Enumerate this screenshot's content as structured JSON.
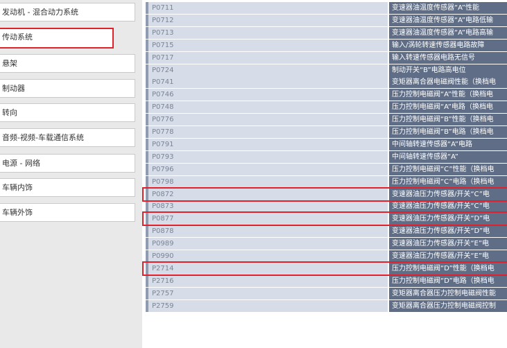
{
  "sidebar": {
    "items": [
      {
        "label": "发动机 - 混合动力系统",
        "selected": false
      },
      {
        "label": "传动系统",
        "selected": true
      },
      {
        "label": "悬架",
        "selected": false
      },
      {
        "label": "制动器",
        "selected": false
      },
      {
        "label": "转向",
        "selected": false
      },
      {
        "label": "音频-视频-车载通信系统",
        "selected": false
      },
      {
        "label": "电源 - 网络",
        "selected": false
      },
      {
        "label": "车辆内饰",
        "selected": false
      },
      {
        "label": "车辆外饰",
        "selected": false
      }
    ]
  },
  "dtc_list": {
    "rows": [
      {
        "code": "P0711",
        "desc": "变速器油温度传感器“A”性能",
        "highlighted": false
      },
      {
        "code": "P0712",
        "desc": "变速器油温度传感器“A”电路低输",
        "highlighted": false
      },
      {
        "code": "P0713",
        "desc": "变速器油温度传感器“A”电路高输",
        "highlighted": false
      },
      {
        "code": "P0715",
        "desc": "输入/涡轮转速传感器电路故障",
        "highlighted": false
      },
      {
        "code": "P0717",
        "desc": "输入转速传感器电路无信号",
        "highlighted": false
      },
      {
        "code": "P0724",
        "desc": "制动开关“B”电路高电位",
        "highlighted": false
      },
      {
        "code": "P0741",
        "desc": "变矩器离合器电磁阀性能（换档电",
        "highlighted": false
      },
      {
        "code": "P0746",
        "desc": "压力控制电磁阀“A”性能（换档电",
        "highlighted": false
      },
      {
        "code": "P0748",
        "desc": "压力控制电磁阀“A”电路（换档电",
        "highlighted": false
      },
      {
        "code": "P0776",
        "desc": "压力控制电磁阀“B”性能（换档电",
        "highlighted": false
      },
      {
        "code": "P0778",
        "desc": "压力控制电磁阀“B”电路（换档电",
        "highlighted": false
      },
      {
        "code": "P0791",
        "desc": "中间轴转速传感器“A”电路",
        "highlighted": false
      },
      {
        "code": "P0793",
        "desc": "中间轴转速传感器“A”",
        "highlighted": false
      },
      {
        "code": "P0796",
        "desc": "压力控制电磁阀“C”性能（换档电",
        "highlighted": false
      },
      {
        "code": "P0798",
        "desc": "压力控制电磁阀“C”电路（换档电",
        "highlighted": false
      },
      {
        "code": "P0872",
        "desc": "变速器油压力传感器/开关“C”电",
        "highlighted": true
      },
      {
        "code": "P0873",
        "desc": "变速器油压力传感器/开关“C”电",
        "highlighted": false
      },
      {
        "code": "P0877",
        "desc": "变速器油压力传感器/开关“D”电",
        "highlighted": true
      },
      {
        "code": "P0878",
        "desc": "变速器油压力传感器/开关“D”电",
        "highlighted": false
      },
      {
        "code": "P0989",
        "desc": "变速器油压力传感器/开关“E”电",
        "highlighted": false
      },
      {
        "code": "P0990",
        "desc": "变速器油压力传感器/开关“E”电",
        "highlighted": false
      },
      {
        "code": "P2714",
        "desc": "压力控制电磁阀“D”性能（换档电",
        "highlighted": true
      },
      {
        "code": "P2716",
        "desc": "压力控制电磁阀“D”电路（换档电",
        "highlighted": false
      },
      {
        "code": "P2757",
        "desc": "变矩器离合器压力控制电磁阀性能",
        "highlighted": false
      },
      {
        "code": "P2759",
        "desc": "变矩器离合器压力控制电磁阀控制",
        "highlighted": false
      }
    ]
  },
  "colors": {
    "highlight": "#e0202a"
  }
}
